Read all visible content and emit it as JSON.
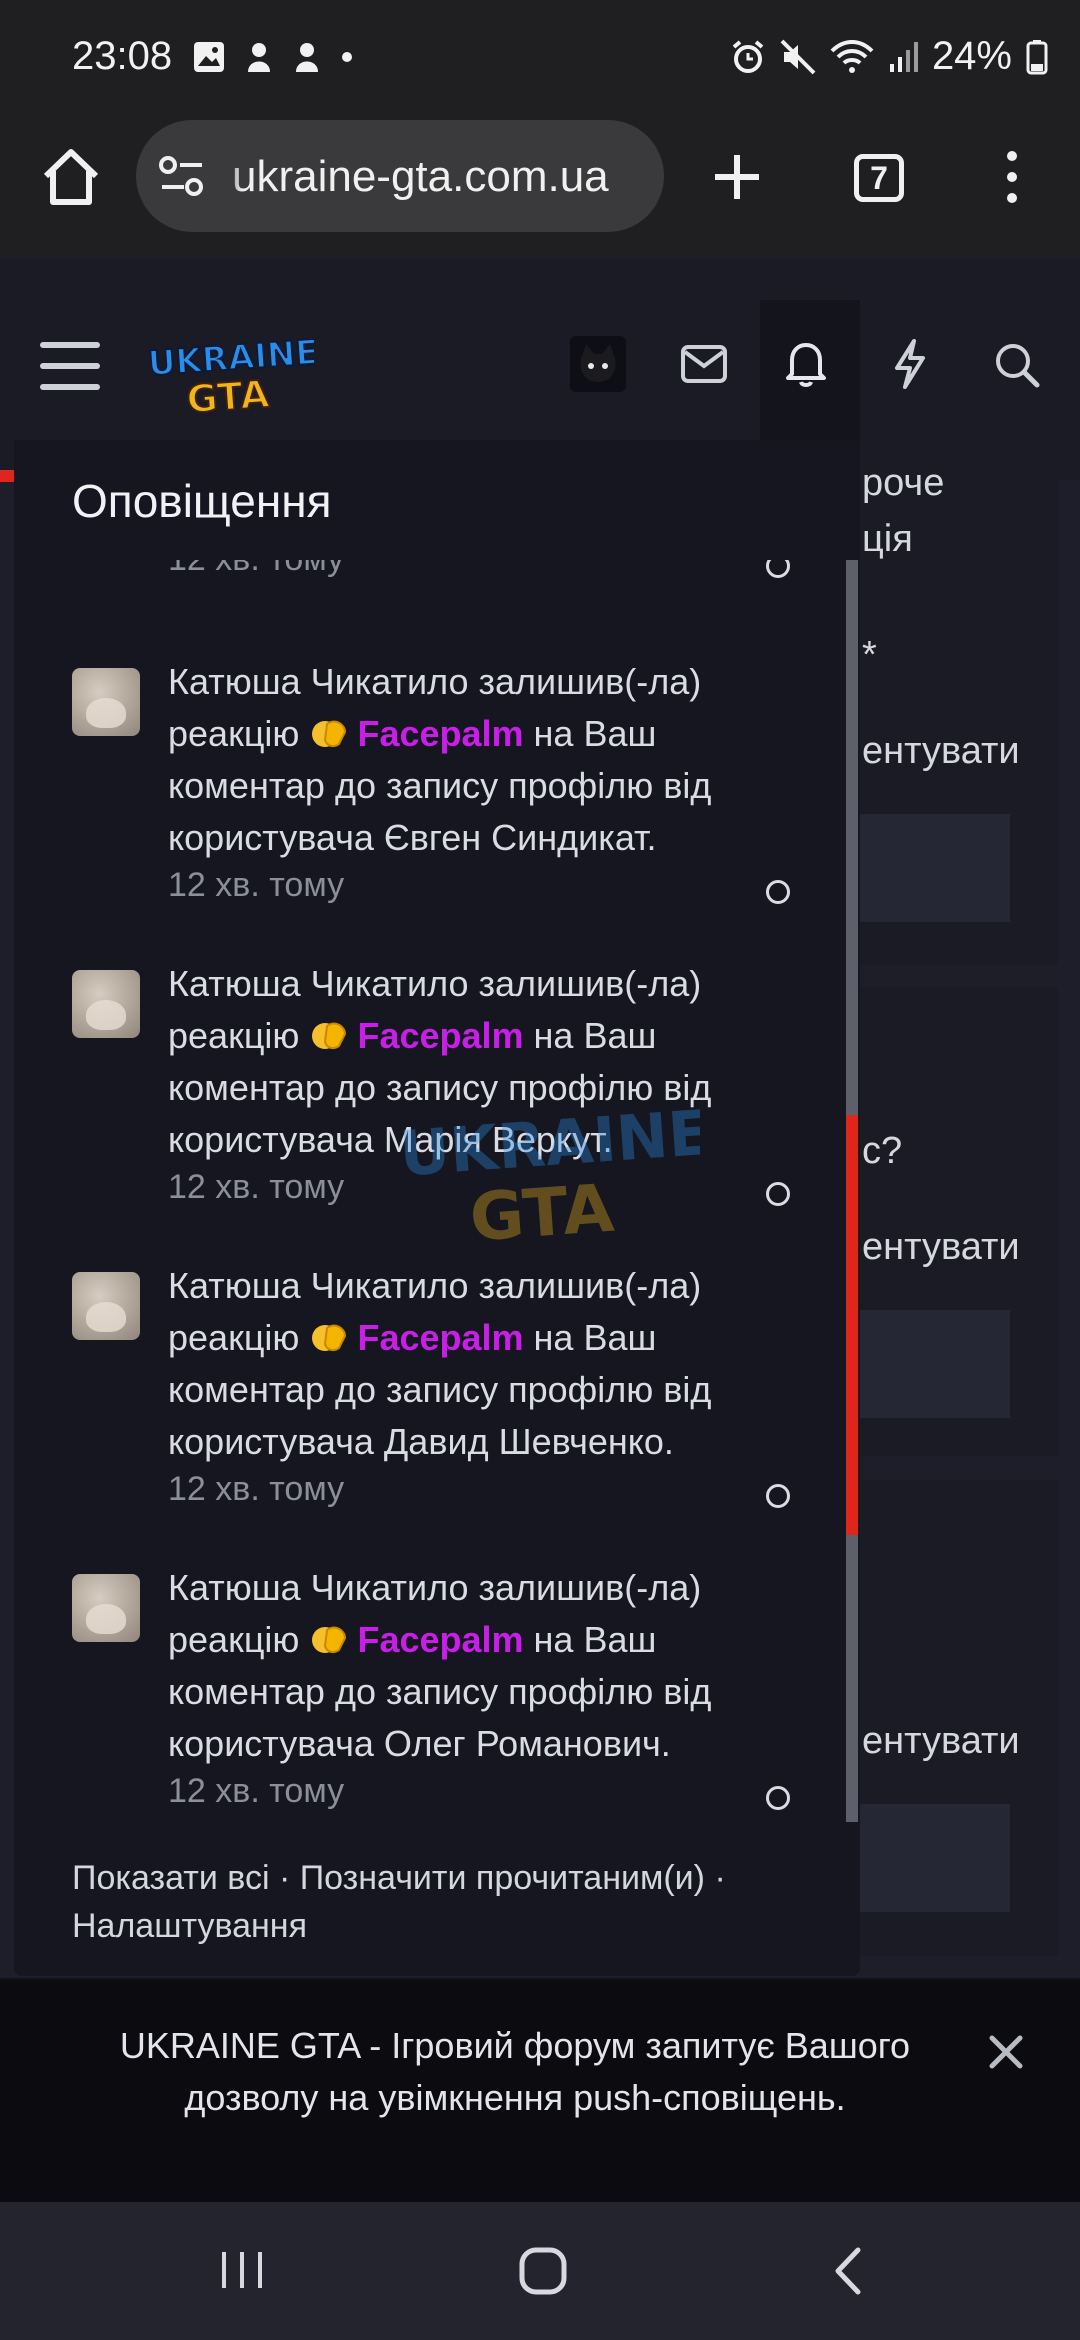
{
  "status_bar": {
    "time": "23:08",
    "battery": "24%",
    "icons_left": [
      "gallery-icon",
      "app-icon",
      "app-icon",
      "dot-icon"
    ],
    "icons_right": [
      "alarm-icon",
      "mute-icon",
      "wifi-icon",
      "signal-icon",
      "battery-icon"
    ]
  },
  "browser": {
    "url": "ukraine-gta.com.ua",
    "tabs_count": "7"
  },
  "site": {
    "logo_text_top": "UKRAINE",
    "logo_text_bottom": "GTA",
    "header_icons": [
      "menu-icon",
      "user-avatar",
      "mail-icon",
      "bell-icon",
      "lightning-icon",
      "search-icon"
    ]
  },
  "background_page": {
    "lines": [
      "роче",
      "ція",
      "*",
      "ентувати",
      "с?",
      "ентувати",
      "ентувати"
    ]
  },
  "notifications": {
    "title": "Оповіщення",
    "first_partial_time": "12 хв. тому",
    "items": [
      {
        "user": "Катюша Чикатило",
        "action": "залишив(-ла)",
        "reaction_prefix": "реакцію",
        "reaction": "Facepalm",
        "suffix": "на Ваш коментар до запису профілю від користувача Євген Синдикат.",
        "time": "12 хв. тому"
      },
      {
        "user": "Катюша Чикатило",
        "action": "залишив(-ла)",
        "reaction_prefix": "реакцію",
        "reaction": "Facepalm",
        "suffix": "на Ваш коментар до запису профілю від користувача Марія Веркут.",
        "time": "12 хв. тому"
      },
      {
        "user": "Катюша Чикатило",
        "action": "залишив(-ла)",
        "reaction_prefix": "реакцію",
        "reaction": "Facepalm",
        "suffix": "на Ваш коментар до запису профілю від користувача Давид Шевченко.",
        "time": "12 хв. тому"
      },
      {
        "user": "Катюша Чикатило",
        "action": "залишив(-ла)",
        "reaction_prefix": "реакцію",
        "reaction": "Facepalm",
        "suffix": "на Ваш коментар до запису профілю від користувача Олег Романович.",
        "time": "12 хв. тому"
      }
    ],
    "footer": {
      "show_all": "Показати всі",
      "mark_read": "Позначити прочитаним(и)",
      "settings": "Налаштування",
      "separator": " · "
    }
  },
  "push_banner": {
    "text": "UKRAINE GTA - Ігровий форум запитує Вашого дозволу на увімкнення push-сповіщень."
  },
  "colors": {
    "accent_red": "#e0251c",
    "reaction_purple": "#c81ee8"
  }
}
